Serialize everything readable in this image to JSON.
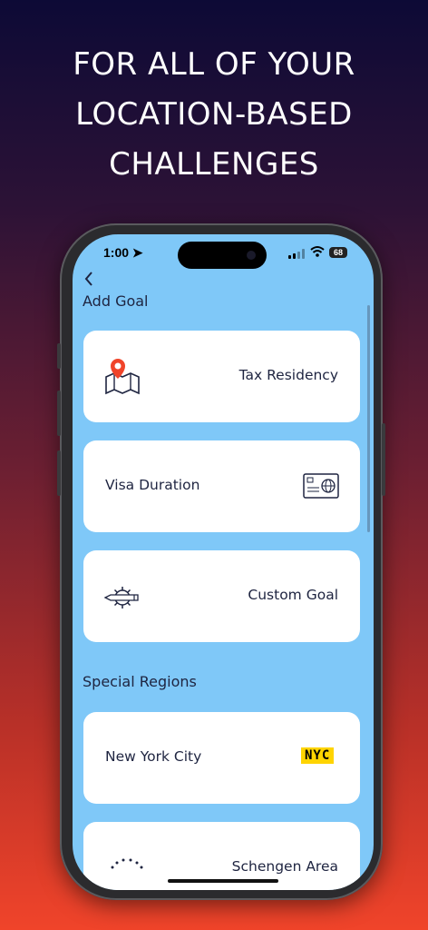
{
  "headline": [
    "FOR ALL OF YOUR",
    "LOCATION-BASED",
    "CHALLENGES"
  ],
  "status_bar": {
    "time": "1:00",
    "battery": "68"
  },
  "nav": {
    "back_icon": "chevron-left-icon"
  },
  "add_goal": {
    "title": "Add Goal",
    "items": [
      {
        "label": "Tax Residency",
        "icon": "map-pin-icon"
      },
      {
        "label": "Visa Duration",
        "icon": "passport-card-icon"
      },
      {
        "label": "Custom Goal",
        "icon": "gear-pencil-icon"
      }
    ]
  },
  "special_regions": {
    "title": "Special Regions",
    "items": [
      {
        "label": "New York City",
        "badge": "NYC"
      },
      {
        "label": "Schengen Area",
        "icon": "eu-stars-icon"
      }
    ]
  },
  "colors": {
    "screen_bg": "#7fc8f8",
    "accent": "#f0442a",
    "text": "#1e2440"
  }
}
